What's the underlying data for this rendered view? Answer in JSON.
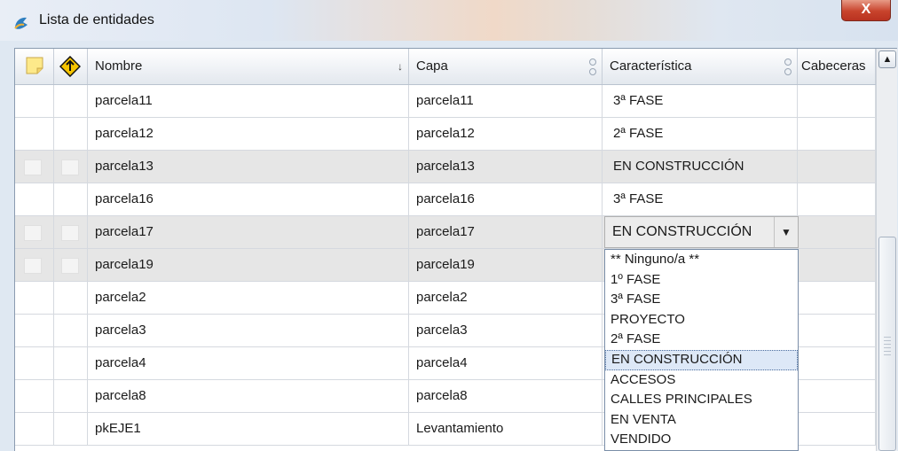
{
  "window": {
    "title": "Lista de entidades",
    "close_label": "X"
  },
  "columns": [
    {
      "label": "Nombre",
      "sort": "↓"
    },
    {
      "label": "Capa"
    },
    {
      "label": "Característica"
    },
    {
      "label": "Cabeceras"
    }
  ],
  "rows": [
    {
      "nombre": "parcela11",
      "capa": "parcela11",
      "caracteristica": "3ª FASE"
    },
    {
      "nombre": "parcela12",
      "capa": "parcela12",
      "caracteristica": "2ª FASE"
    },
    {
      "nombre": "parcela13",
      "capa": "parcela13",
      "caracteristica": "EN CONSTRUCCIÓN"
    },
    {
      "nombre": "parcela16",
      "capa": "parcela16",
      "caracteristica": "3ª FASE"
    },
    {
      "nombre": "parcela17",
      "capa": "parcela17",
      "caracteristica": "EN CONSTRUCCIÓN"
    },
    {
      "nombre": "parcela19",
      "capa": "parcela19",
      "caracteristica": ""
    },
    {
      "nombre": "parcela2",
      "capa": "parcela2",
      "caracteristica": ""
    },
    {
      "nombre": "parcela3",
      "capa": "parcela3",
      "caracteristica": ""
    },
    {
      "nombre": "parcela4",
      "capa": "parcela4",
      "caracteristica": ""
    },
    {
      "nombre": "parcela8",
      "capa": "parcela8",
      "caracteristica": ""
    },
    {
      "nombre": "pkEJE1",
      "capa": "Levantamiento",
      "caracteristica": ""
    }
  ],
  "editor": {
    "value": "EN CONSTRUCCIÓN",
    "options": [
      "** Ninguno/a **",
      "1º FASE",
      "3ª FASE",
      "PROYECTO",
      "2ª FASE",
      "EN CONSTRUCCIÓN",
      "ACCESOS",
      "CALLES PRINCIPALES",
      "EN VENTA",
      "VENDIDO"
    ],
    "selected_option": "EN CONSTRUCCIÓN"
  },
  "icons": {
    "app": "app-icon",
    "note": "note-icon",
    "warning": "warning-icon",
    "scroll_up": "scroll-up-arrow"
  },
  "colors": {
    "alt_row": "#e6e6e6",
    "close": "#c8432c",
    "warning": "#f5c400"
  }
}
